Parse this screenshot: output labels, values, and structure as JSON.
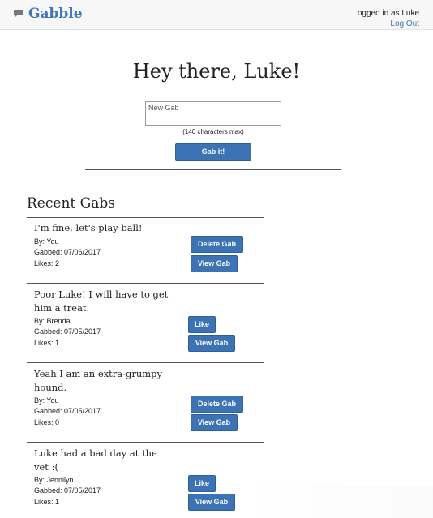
{
  "header": {
    "app_name": "Gabble",
    "login_status": "Logged in as Luke",
    "logout_label": "Log Out",
    "accent_color": "#3f78b5"
  },
  "compose": {
    "greeting": "Hey there, Luke!",
    "placeholder": "New Gab",
    "value": "",
    "limit_note": "(140 characters max)",
    "submit_label": "Gab it!"
  },
  "recent": {
    "title": "Recent Gabs",
    "gabs": [
      {
        "text_lines": [
          "I'm fine, let's play ball!"
        ],
        "author": "By: You",
        "date": "Gabbed: 07/06/2017",
        "likes": "Likes: 2",
        "primary_action": "Delete Gab",
        "secondary_action": "View Gab"
      },
      {
        "text_lines": [
          "Poor Luke! I will have to get",
          "him a treat."
        ],
        "author": "By: Brenda",
        "date": "Gabbed: 07/05/2017",
        "likes": "Likes: 1",
        "primary_action": "Like",
        "secondary_action": "View Gab"
      },
      {
        "text_lines": [
          "Yeah I am an extra-grumpy",
          "hound."
        ],
        "author": "By: You",
        "date": "Gabbed: 07/05/2017",
        "likes": "Likes: 0",
        "primary_action": "Delete Gab",
        "secondary_action": "View Gab"
      },
      {
        "text_lines": [
          "Luke had a bad day at the",
          "vet :("
        ],
        "author": "By: Jennilyn",
        "date": "Gabbed: 07/05/2017",
        "likes": "Likes: 1",
        "primary_action": "Like",
        "secondary_action": "View Gab"
      }
    ]
  }
}
